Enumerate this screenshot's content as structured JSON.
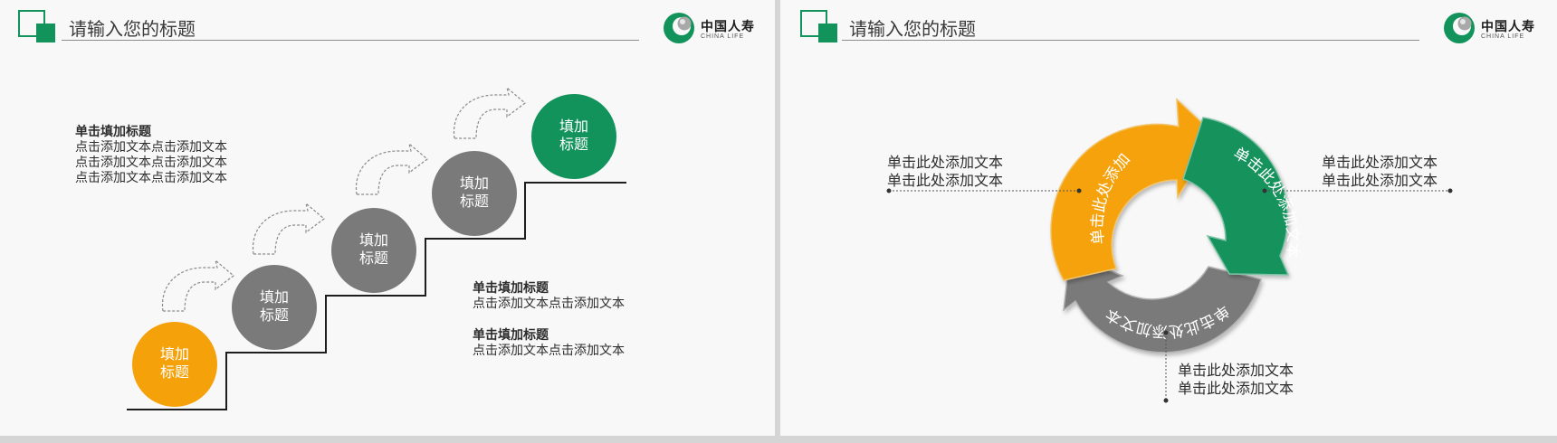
{
  "colors": {
    "green": "#13935c",
    "orange": "#f5a20a",
    "gray": "#7a7a7a",
    "text": "#2d2d2d"
  },
  "slide1": {
    "header": {
      "title": "请输入您的标题"
    },
    "logo": {
      "cn": "中国人寿",
      "en": "CHINA LIFE"
    },
    "steps": [
      {
        "line1": "填加",
        "line2": "标题",
        "color": "orange"
      },
      {
        "line1": "填加",
        "line2": "标题",
        "color": "gray"
      },
      {
        "line1": "填加",
        "line2": "标题",
        "color": "gray"
      },
      {
        "line1": "填加",
        "line2": "标题",
        "color": "gray"
      },
      {
        "line1": "填加",
        "line2": "标题",
        "color": "green"
      }
    ],
    "top_text": {
      "title": "单击填加标题",
      "lines": [
        "点击添加文本点击添加文本",
        "点击添加文本点击添加文本",
        "点击添加文本点击添加文本"
      ]
    },
    "bottom_blocks": [
      {
        "title": "单击填加标题",
        "text": "点击添加文本点击添加文本"
      },
      {
        "title": "单击填加标题",
        "text": "点击添加文本点击添加文本"
      }
    ]
  },
  "slide2": {
    "header": {
      "title": "请输入您的标题"
    },
    "logo": {
      "cn": "中国人寿",
      "en": "CHINA LIFE"
    },
    "arrows": {
      "orange_label": "单击此处添加文本",
      "green_label": "单击此处添加文本",
      "gray_label": "单击此处添加文本"
    },
    "callouts": {
      "left": [
        "单击此处添加文本",
        "单击此处添加文本"
      ],
      "right": [
        "单击此处添加文本",
        "单击此处添加文本"
      ],
      "bottom": [
        "单击此处添加文本",
        "单击此处添加文本"
      ]
    }
  }
}
